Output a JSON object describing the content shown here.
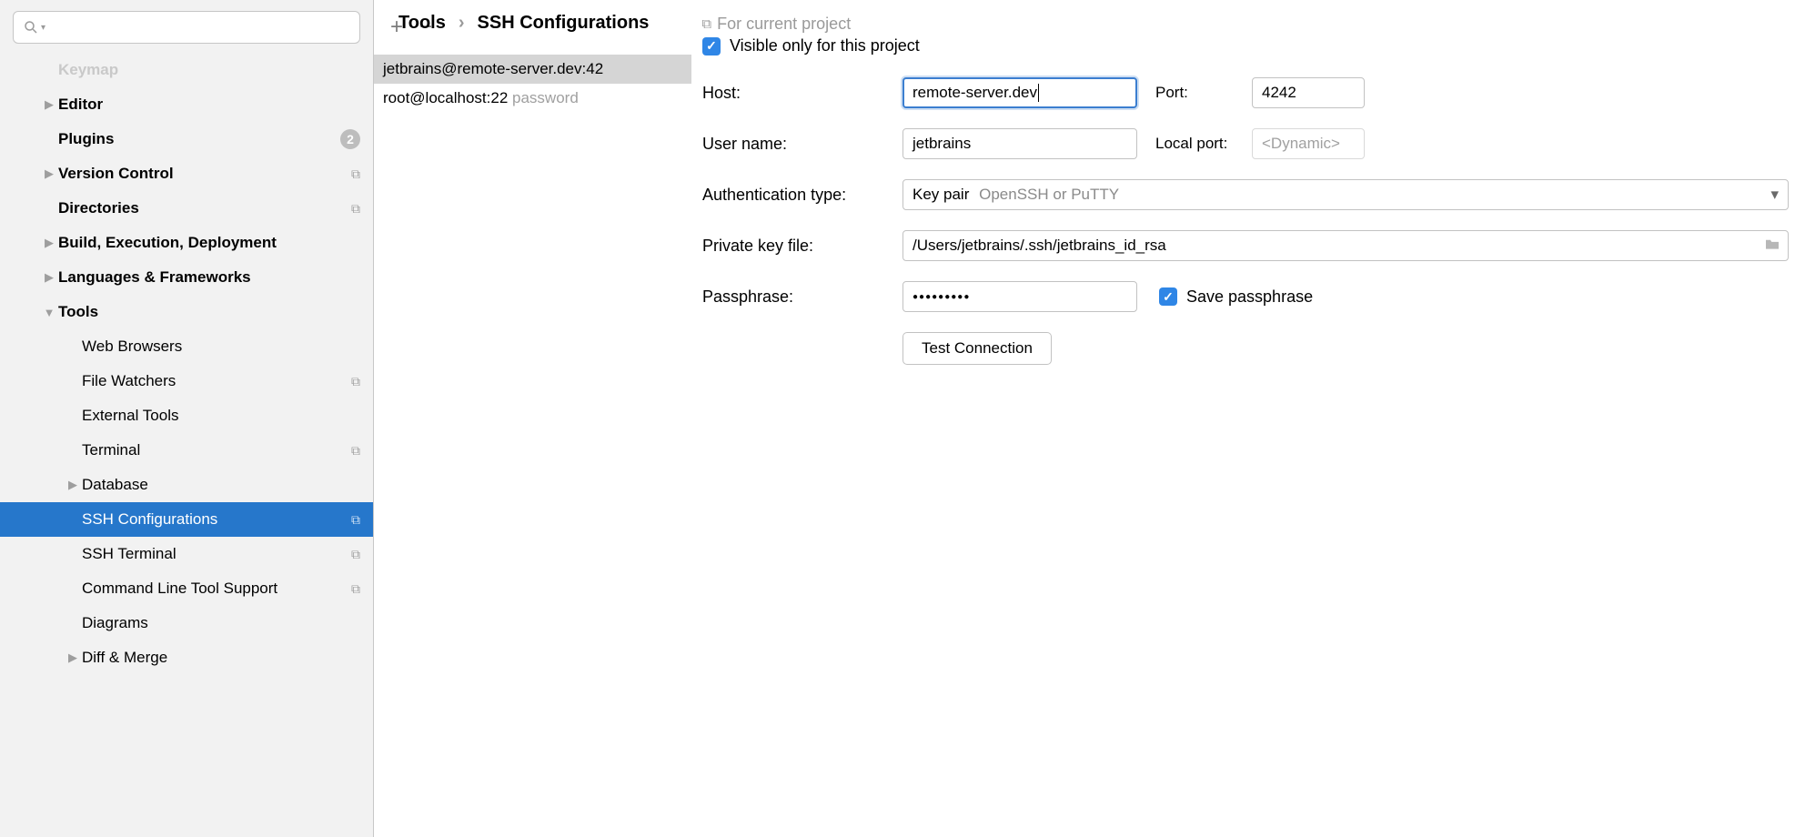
{
  "breadcrumb": {
    "root": "Tools",
    "sep": "›",
    "current": "SSH Configurations",
    "scope": "For current project"
  },
  "sidebar": {
    "items": [
      {
        "label": "Keymap",
        "indent": 1,
        "bold": true,
        "ghost": true,
        "arrow": "none",
        "trailing": "none"
      },
      {
        "label": "Editor",
        "indent": 1,
        "bold": true,
        "arrow": "right",
        "trailing": "none"
      },
      {
        "label": "Plugins",
        "indent": 1,
        "bold": true,
        "arrow": "none",
        "trailing": "count",
        "count": "2"
      },
      {
        "label": "Version Control",
        "indent": 1,
        "bold": true,
        "arrow": "right",
        "trailing": "copy"
      },
      {
        "label": "Directories",
        "indent": 1,
        "bold": true,
        "arrow": "none",
        "trailing": "copy"
      },
      {
        "label": "Build, Execution, Deployment",
        "indent": 1,
        "bold": true,
        "arrow": "right",
        "trailing": "none"
      },
      {
        "label": "Languages & Frameworks",
        "indent": 1,
        "bold": true,
        "arrow": "right",
        "trailing": "none"
      },
      {
        "label": "Tools",
        "indent": 1,
        "bold": true,
        "arrow": "down",
        "trailing": "none"
      },
      {
        "label": "Web Browsers",
        "indent": 2,
        "arrow": "none",
        "trailing": "none"
      },
      {
        "label": "File Watchers",
        "indent": 2,
        "arrow": "none",
        "trailing": "copy"
      },
      {
        "label": "External Tools",
        "indent": 2,
        "arrow": "none",
        "trailing": "none"
      },
      {
        "label": "Terminal",
        "indent": 2,
        "arrow": "none",
        "trailing": "copy"
      },
      {
        "label": "Database",
        "indent": 2,
        "arrow": "right",
        "trailing": "none"
      },
      {
        "label": "SSH Configurations",
        "indent": 2,
        "arrow": "none",
        "trailing": "copy",
        "selected": true
      },
      {
        "label": "SSH Terminal",
        "indent": 2,
        "arrow": "none",
        "trailing": "copy"
      },
      {
        "label": "Command Line Tool Support",
        "indent": 2,
        "arrow": "none",
        "trailing": "copy"
      },
      {
        "label": "Diagrams",
        "indent": 2,
        "arrow": "none",
        "trailing": "none"
      },
      {
        "label": "Diff & Merge",
        "indent": 2,
        "arrow": "right",
        "trailing": "none"
      }
    ]
  },
  "toolbar": {
    "add": "+",
    "remove": "−"
  },
  "configs": [
    {
      "label": "jetbrains@remote-server.dev:42",
      "suffix": "",
      "active": true
    },
    {
      "label": "root@localhost:22",
      "suffix": "password",
      "active": false
    }
  ],
  "form": {
    "visible_only": "Visible only for this project",
    "host_label": "Host:",
    "host_value": "remote-server.dev",
    "port_label": "Port:",
    "port_value": "4242",
    "user_label": "User name:",
    "user_value": "jetbrains",
    "local_port_label": "Local port:",
    "local_port_placeholder": "<Dynamic>",
    "auth_label": "Authentication type:",
    "auth_value": "Key pair",
    "auth_hint": "OpenSSH or PuTTY",
    "key_label": "Private key file:",
    "key_value": "/Users/jetbrains/.ssh/jetbrains_id_rsa",
    "pass_label": "Passphrase:",
    "pass_mask": "●●●●●●●●●",
    "save_pass": "Save passphrase",
    "test_btn": "Test Connection"
  }
}
